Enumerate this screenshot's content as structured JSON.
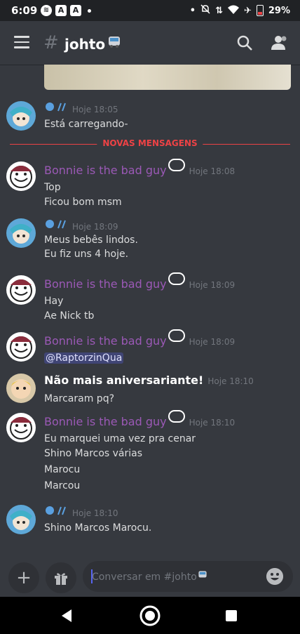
{
  "status_bar": {
    "time": "6:09",
    "battery": "29%",
    "app_icon_a": "A",
    "app_icon_b": "A"
  },
  "header": {
    "channel": "johto"
  },
  "divider": {
    "label": "NOVAS MENSAGENS"
  },
  "messages": [
    {
      "author": "",
      "time": "Hoje 18:05",
      "lines": [
        "Está carregando-"
      ]
    },
    {
      "author": "Bonnie is the bad guy",
      "time": "Hoje 18:08",
      "lines": [
        "Top",
        "Ficou bom msm"
      ]
    },
    {
      "author": "",
      "time": "Hoje 18:09",
      "lines": [
        "Meus bebês lindos.",
        "Eu fiz uns 4 hoje."
      ]
    },
    {
      "author": "Bonnie is the bad guy",
      "time": "Hoje 18:09",
      "lines": [
        "Hay",
        "Ae Nick tb"
      ]
    },
    {
      "author": "Bonnie is the bad guy",
      "time": "Hoje 18:09",
      "lines": [
        "@RaptorzinQua"
      ]
    },
    {
      "author": "Não mais aniversariante!",
      "time": "Hoje 18:10",
      "lines": [
        "Marcaram pq?"
      ]
    },
    {
      "author": "Bonnie is the bad guy",
      "time": "Hoje 18:10",
      "lines": [
        "Eu marquei uma vez pra cenar",
        "Shino Marcos várias",
        "Marocu",
        "Marcou"
      ]
    },
    {
      "author": "",
      "time": "Hoje 18:10",
      "lines": [
        "Shino Marcos Marocu."
      ]
    }
  ],
  "composer": {
    "placeholder": "Conversar em #johto"
  },
  "colors": {
    "background": "#36393f",
    "username": "#9b59b6",
    "new_messages": "#ed4245",
    "mention": "#5865f2"
  }
}
